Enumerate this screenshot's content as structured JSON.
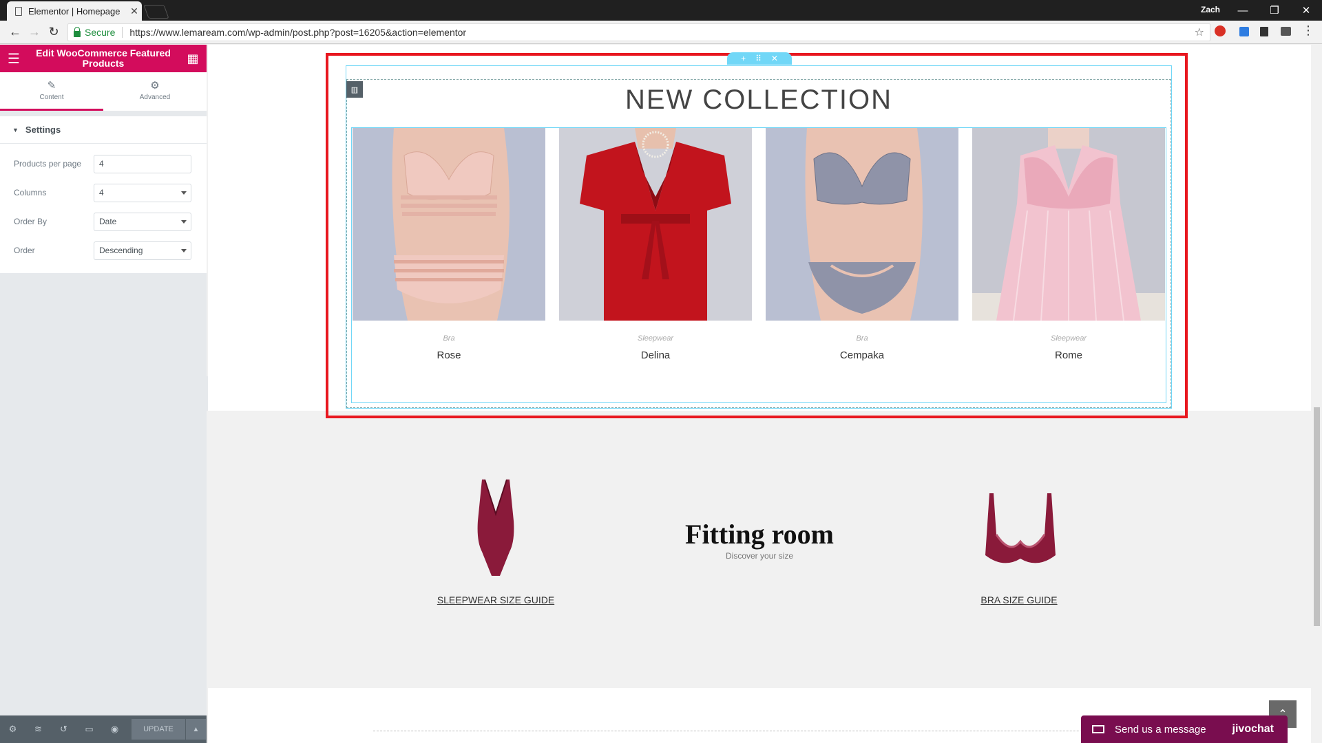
{
  "browser": {
    "tab_title": "Elementor | Homepage",
    "tab_close": "✕",
    "profile_name": "Zach",
    "window_controls": [
      "—",
      "❐",
      "✕"
    ],
    "secure_label": "Secure",
    "url": "https://www.lemaream.com/wp-admin/post.php?post=16205&action=elementor"
  },
  "panel": {
    "title": "Edit WooCommerce Featured Products",
    "tabs": [
      {
        "label": "Content",
        "icon": "pencil-icon"
      },
      {
        "label": "Advanced",
        "icon": "gear-icon"
      }
    ],
    "section_title": "Settings",
    "controls": [
      {
        "label": "Products per page",
        "value": "4",
        "type": "text"
      },
      {
        "label": "Columns",
        "value": "4",
        "type": "select"
      },
      {
        "label": "Order By",
        "value": "Date",
        "type": "select"
      },
      {
        "label": "Order",
        "value": "Descending",
        "type": "select"
      }
    ],
    "footer": {
      "update_label": "UPDATE",
      "icons": [
        "gear-icon",
        "layers-icon",
        "history-icon",
        "desktop-icon",
        "eye-icon"
      ]
    }
  },
  "preview": {
    "heading": "NEW COLLECTION",
    "products": [
      {
        "category": "Bra",
        "name": "Rose",
        "color": "#e8b9ae"
      },
      {
        "category": "Sleepwear",
        "name": "Delina",
        "color": "#c2141d"
      },
      {
        "category": "Bra",
        "name": "Cempaka",
        "color": "#8f93a8"
      },
      {
        "category": "Sleepwear",
        "name": "Rome",
        "color": "#f2c3cf"
      }
    ],
    "fitting_title": "Fitting room",
    "fitting_subtitle": "Discover your size",
    "sleepwear_guide": "SLEEPWEAR SIZE GUIDE",
    "bra_guide": "BRA SIZE GUIDE"
  },
  "chat": {
    "label": "Send us a message",
    "brand": "jivochat"
  },
  "colors": {
    "elementor_accent": "#d30c5c",
    "selection_red": "#e8171f",
    "widget_outline": "#71d7f7",
    "chat_bg": "#790d4f",
    "product_burgundy": "#8a1a3a"
  }
}
